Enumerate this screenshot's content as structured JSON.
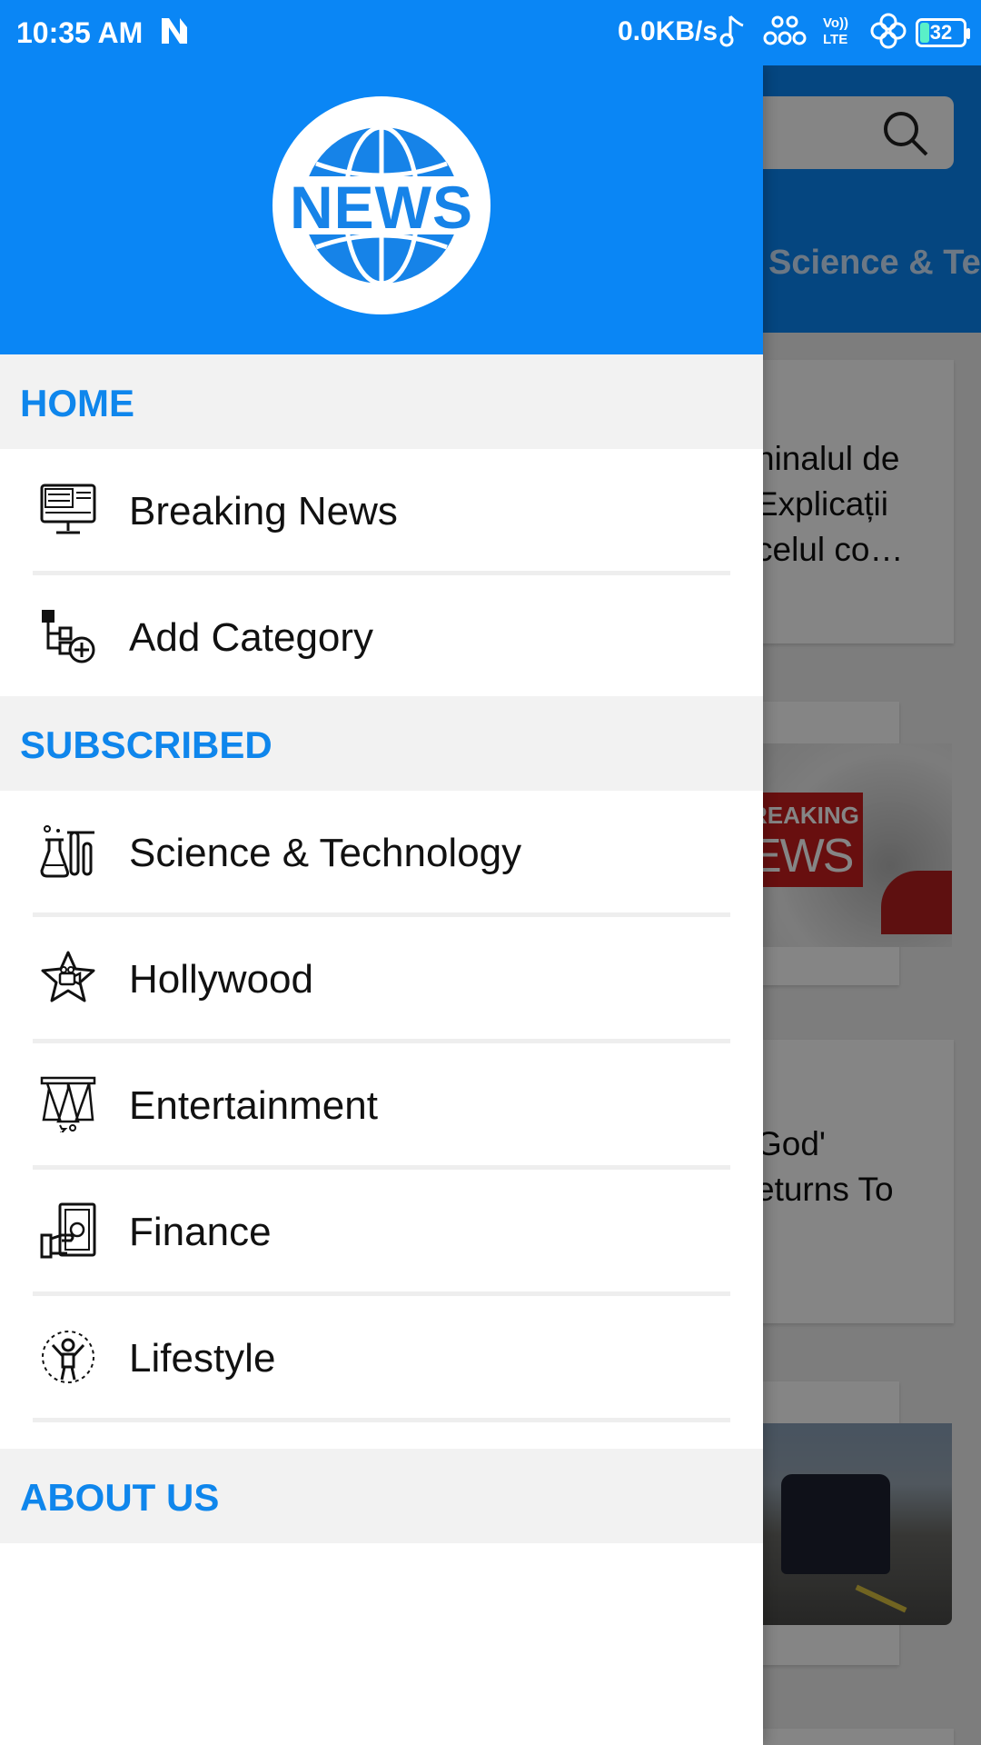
{
  "status_bar": {
    "time": "10:35 AM",
    "speed": "0.0KB/s",
    "battery": "32",
    "icons": [
      "n-icon",
      "music-note-icon",
      "network-dots-icon",
      "volte-icon",
      "clover-icon",
      "battery-icon"
    ],
    "volte_line1": "Vo))",
    "volte_line2": "LTE"
  },
  "drawer": {
    "logo_text": "NEWS",
    "sections": {
      "home": "HOME",
      "subscribed": "SUBSCRIBED",
      "about": "ABOUT US"
    },
    "home_items": [
      {
        "label": "Breaking News",
        "icon": "breaking-news-monitor-icon"
      },
      {
        "label": "Add Category",
        "icon": "add-category-icon"
      }
    ],
    "subscribed_items": [
      {
        "label": "Science & Technology",
        "icon": "lab-flask-icon"
      },
      {
        "label": "Hollywood",
        "icon": "star-camera-icon"
      },
      {
        "label": "Entertainment",
        "icon": "spotlight-icon"
      },
      {
        "label": "Finance",
        "icon": "money-hand-icon"
      },
      {
        "label": "Lifestyle",
        "icon": "person-cheering-icon"
      }
    ]
  },
  "background": {
    "tab_label": "Science & Te",
    "card1_lines": [
      "ninalul de",
      "Explicații",
      "celul co…"
    ],
    "card2_image_line1": "REAKING",
    "card2_image_line2": "EWS",
    "card3_lines": [
      "God'",
      "eturns To"
    ]
  },
  "colors": {
    "primary": "#0a86f5",
    "section_text": "#0f86ec",
    "section_bg": "#f2f2f2"
  }
}
